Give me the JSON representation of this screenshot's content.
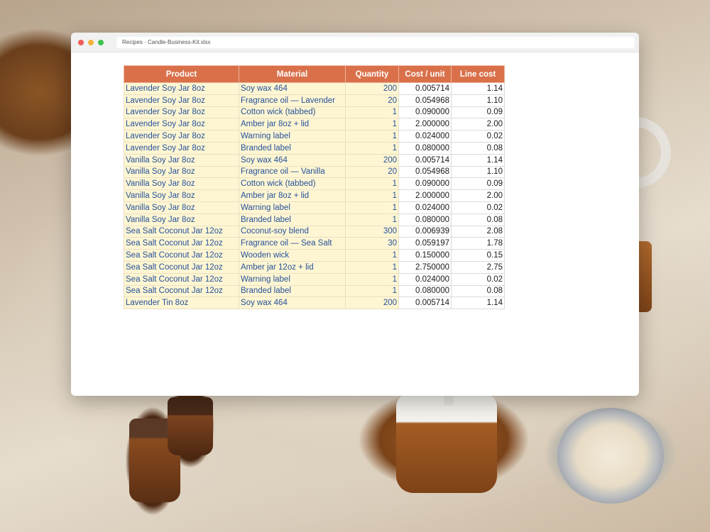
{
  "window": {
    "title": "Recipes · Candle-Business-Kit.xlsx"
  },
  "sheet": {
    "headers": [
      "Product",
      "Material",
      "Quantity",
      "Cost / unit",
      "Line cost"
    ],
    "rows": [
      [
        "Lavender Soy Jar 8oz",
        "Soy wax 464",
        "200",
        "0.005714",
        "1.14"
      ],
      [
        "Lavender Soy Jar 8oz",
        "Fragrance oil — Lavender",
        "20",
        "0.054968",
        "1.10"
      ],
      [
        "Lavender Soy Jar 8oz",
        "Cotton wick (tabbed)",
        "1",
        "0.090000",
        "0.09"
      ],
      [
        "Lavender Soy Jar 8oz",
        "Amber jar 8oz + lid",
        "1",
        "2.000000",
        "2.00"
      ],
      [
        "Lavender Soy Jar 8oz",
        "Warning label",
        "1",
        "0.024000",
        "0.02"
      ],
      [
        "Lavender Soy Jar 8oz",
        "Branded label",
        "1",
        "0.080000",
        "0.08"
      ],
      [
        "Vanilla Soy Jar 8oz",
        "Soy wax 464",
        "200",
        "0.005714",
        "1.14"
      ],
      [
        "Vanilla Soy Jar 8oz",
        "Fragrance oil — Vanilla",
        "20",
        "0.054968",
        "1.10"
      ],
      [
        "Vanilla Soy Jar 8oz",
        "Cotton wick (tabbed)",
        "1",
        "0.090000",
        "0.09"
      ],
      [
        "Vanilla Soy Jar 8oz",
        "Amber jar 8oz + lid",
        "1",
        "2.000000",
        "2.00"
      ],
      [
        "Vanilla Soy Jar 8oz",
        "Warning label",
        "1",
        "0.024000",
        "0.02"
      ],
      [
        "Vanilla Soy Jar 8oz",
        "Branded label",
        "1",
        "0.080000",
        "0.08"
      ],
      [
        "Sea Salt Coconut Jar 12oz",
        "Coconut-soy blend",
        "300",
        "0.006939",
        "2.08"
      ],
      [
        "Sea Salt Coconut Jar 12oz",
        "Fragrance oil — Sea Salt",
        "30",
        "0.059197",
        "1.78"
      ],
      [
        "Sea Salt Coconut Jar 12oz",
        "Wooden wick",
        "1",
        "0.150000",
        "0.15"
      ],
      [
        "Sea Salt Coconut Jar 12oz",
        "Amber jar 12oz + lid",
        "1",
        "2.750000",
        "2.75"
      ],
      [
        "Sea Salt Coconut Jar 12oz",
        "Warning label",
        "1",
        "0.024000",
        "0.02"
      ],
      [
        "Sea Salt Coconut Jar 12oz",
        "Branded label",
        "1",
        "0.080000",
        "0.08"
      ],
      [
        "Lavender Tin 8oz",
        "Soy wax 464",
        "200",
        "0.005714",
        "1.14"
      ]
    ]
  },
  "colors": {
    "header_bg": "#d9704a",
    "input_cell_bg": "#fef6d2",
    "input_text": "#26519c"
  }
}
